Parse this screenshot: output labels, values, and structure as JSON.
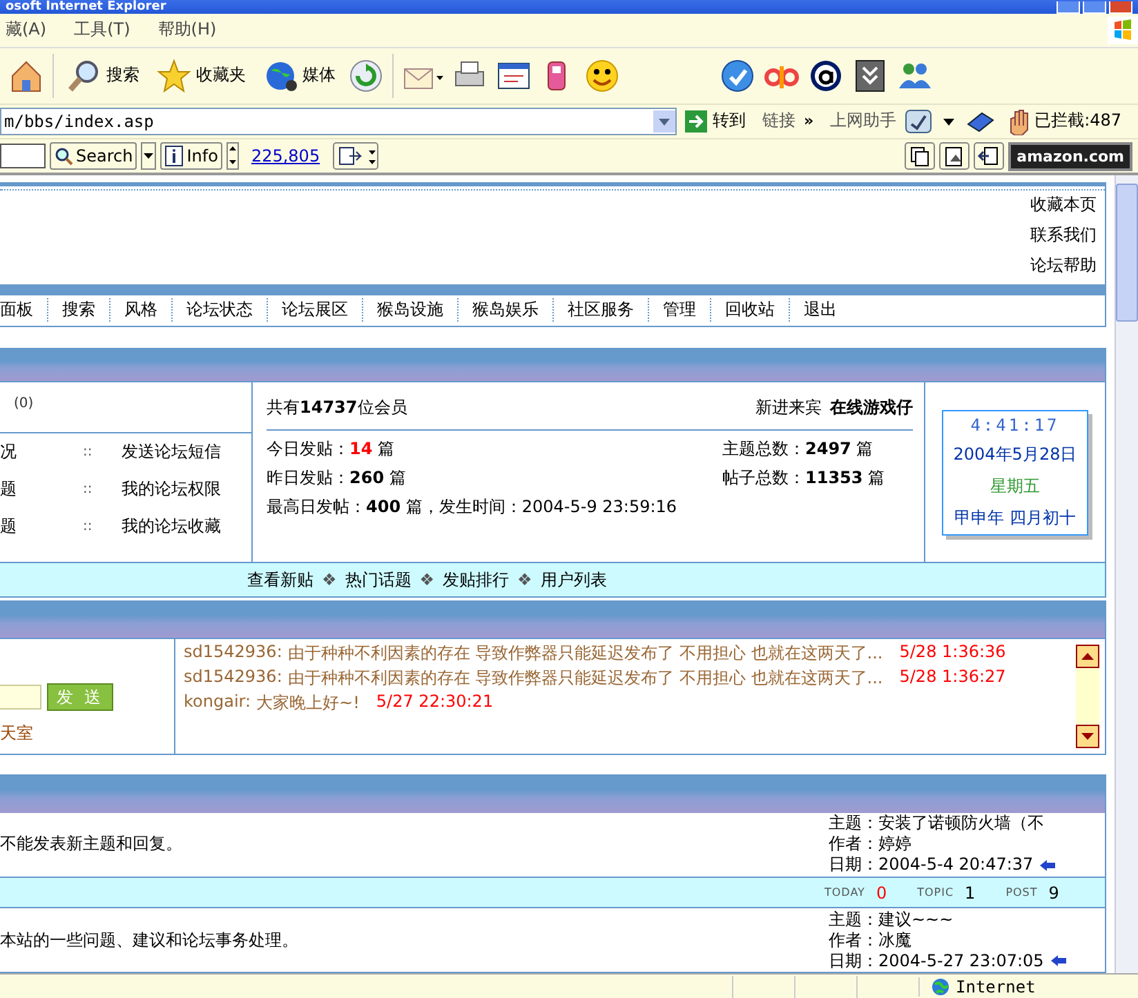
{
  "window": {
    "title": "osoft Internet Explorer"
  },
  "menu": [
    {
      "label": "藏(A)"
    },
    {
      "label": "工具(T)"
    },
    {
      "label": "帮助(H)"
    }
  ],
  "toolbar": {
    "buttons": [
      {
        "label": "搜索"
      },
      {
        "label": "收藏夹"
      },
      {
        "label": "媒体"
      }
    ]
  },
  "address": {
    "value": "m/bbs/index.asp",
    "go": "转到",
    "links": "链接",
    "more": "»",
    "helper": "上网助手",
    "blocked": "已拦截:487"
  },
  "searchbar": {
    "search": "Search",
    "info": "Info",
    "count": "225,805",
    "amazon": "amazon.com"
  },
  "page": {
    "header_links": [
      "收藏本页",
      "联系我们",
      "论坛帮助"
    ],
    "nav": [
      "面板",
      "搜索",
      "风格",
      "论坛状态",
      "论坛展区",
      "猴岛设施",
      "猴岛娱乐",
      "社区服务",
      "管理",
      "回收站",
      "退出"
    ],
    "user_panel": {
      "count": "(0)",
      "rows": [
        {
          "left": "况",
          "sep": "::",
          "right": "发送论坛短信"
        },
        {
          "left": "题",
          "sep": "::",
          "right": "我的论坛权限"
        },
        {
          "left": "题",
          "sep": "::",
          "right": "我的论坛收藏"
        }
      ]
    },
    "stats": {
      "members": "共有**14737**位会员",
      "newest_label": "新进来宾",
      "newest_name": "在线游戏仔",
      "items": [
        {
          "label": "今日发贴：",
          "value": "14",
          "unit": "篇",
          "highlight": true
        },
        {
          "label": "主题总数：",
          "value": "2497",
          "unit": "篇",
          "highlight": false
        },
        {
          "label": "昨日发贴：",
          "value": "260",
          "unit": "篇",
          "highlight": false
        },
        {
          "label": "帖子总数：",
          "value": "11353",
          "unit": "篇",
          "highlight": false
        }
      ],
      "record": "最高日发帖：**400** 篇，发生时间：2004-5-9 23:59:16"
    },
    "clock": {
      "time": "4:41:17",
      "date": "2004年5月28日",
      "weekday": "星期五",
      "lunar": "甲申年 四月初十"
    },
    "quick_links": [
      {
        "label": "查看新贴",
        "sep": "❖"
      },
      {
        "label": "热门话题",
        "sep": "❖"
      },
      {
        "label": "发贴排行",
        "sep": "❖"
      },
      {
        "label": "用户列表"
      }
    ],
    "chat": {
      "send": "发 送",
      "room": "天室",
      "messages": [
        {
          "user": "sd1542936:",
          "text": "由于种种不利因素的存在 导致作弊器只能延迟发布了 不用担心 也就在这两天了...",
          "time": "5/28 1:36:36"
        },
        {
          "user": "sd1542936:",
          "text": "由于种种不利因素的存在 导致作弊器只能延迟发布了 不用担心 也就在这两天了...",
          "time": "5/28 1:36:27"
        },
        {
          "user": "kongair:",
          "text": "大家晚上好~!",
          "time": "5/27 22:30:21"
        }
      ]
    },
    "forums": [
      {
        "description": "不能发表新主题和回复。",
        "topic": "主题：安装了诺顿防火墙（不",
        "author": "作者：婷婷",
        "date": "日期：2004-5-4 20:47:37",
        "stats": [
          {
            "label": "TODAY",
            "value": "0",
            "highlight": true
          },
          {
            "label": "TOPIC",
            "value": "1",
            "highlight": false
          },
          {
            "label": "POST",
            "value": "9",
            "highlight": false
          }
        ]
      },
      {
        "description": "本站的一些问题、建议和论坛事务处理。",
        "topic": "主题：建议~~~",
        "author": "作者：冰魔",
        "date": "日期：2004-5-27 23:07:05"
      }
    ]
  },
  "status_bar": {
    "zone": "Internet"
  }
}
